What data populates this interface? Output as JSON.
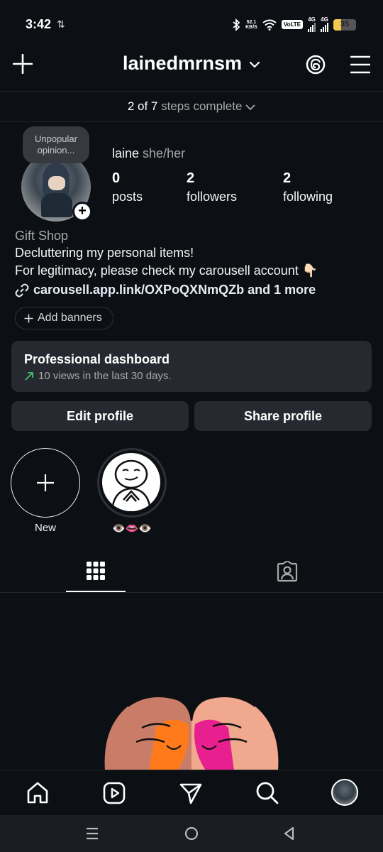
{
  "status_bar": {
    "time": "3:42",
    "left_icon": "⇅",
    "speed_top": "52.1",
    "speed_bottom": "KB/S",
    "volte": "VoLTE",
    "network_1": "4G",
    "network_2": "4G",
    "battery": "35",
    "battery_level": 0.35,
    "icons": [
      "bluetooth-icon",
      "wifi-icon",
      "signal-icon",
      "battery-icon"
    ]
  },
  "header": {
    "username": "lainedmrnsm",
    "icons": [
      "plus-icon",
      "chevron-down-icon",
      "threads-icon",
      "menu-icon"
    ]
  },
  "steps": {
    "count": "2 of 7",
    "label": "steps complete"
  },
  "profile": {
    "note": "Unpopular opinion...",
    "name": "laine",
    "pronouns": "she/her",
    "stats": [
      {
        "value": "0",
        "label": "posts"
      },
      {
        "value": "2",
        "label": "followers"
      },
      {
        "value": "2",
        "label": "following"
      }
    ],
    "category": "Gift Shop",
    "bio_lines": [
      "Decluttering my personal items!",
      "For legitimacy, please check my carousell account 👇🏻"
    ],
    "link": "carousell.app.link/OXPoQXNmQZb and 1 more",
    "add_banners": "Add banners"
  },
  "dashboard": {
    "title": "Professional dashboard",
    "subtitle": "10 views in the last 30 days.",
    "accent": "#3ec46d"
  },
  "actions": {
    "edit": "Edit profile",
    "share": "Share profile"
  },
  "highlights": [
    {
      "label": "New"
    },
    {
      "label": "👁️👄👁️"
    }
  ],
  "tabs": [
    "grid-icon",
    "tagged-icon"
  ],
  "bottom_nav": [
    "home-icon",
    "reels-icon",
    "send-icon",
    "search-icon",
    "profile-avatar"
  ],
  "system_nav": [
    "recents-icon",
    "home-circle-icon",
    "back-icon"
  ]
}
